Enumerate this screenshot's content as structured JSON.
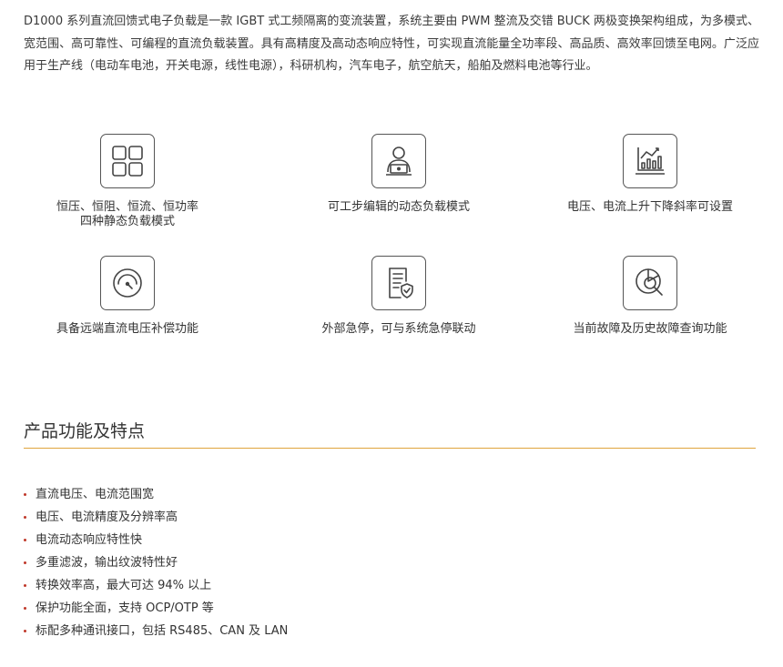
{
  "intro": {
    "text": "D1000 系列直流回馈式电子负载是一款 IGBT 式工频隔离的变流装置，系统主要由 PWM 整流及交错 BUCK 两极变换架构组成，为多模式、宽范围、高可靠性、可编程的直流负载装置。具有高精度及高动态响应特性，可实现直流能量全功率段、高品质、高效率回馈至电网。广泛应用于生产线（电动车电池，开关电源，线性电源），科研机构，汽车电子，航空航天，船舶及燃料电池等行业。"
  },
  "features": [
    {
      "icon": "grid-icon",
      "lines": [
        "恒压、恒阻、恒流、恒功率",
        "四种静态负载模式"
      ]
    },
    {
      "icon": "user-laptop-icon",
      "lines": [
        "可工步编辑的动态负载模式"
      ]
    },
    {
      "icon": "line-chart-icon",
      "lines": [
        "电压、电流上升下降斜率可设置"
      ]
    },
    {
      "icon": "gauge-icon",
      "lines": [
        "具备远端直流电压补偿功能"
      ]
    },
    {
      "icon": "document-shield-icon",
      "lines": [
        "外部急停，可与系统急停联动"
      ]
    },
    {
      "icon": "pie-chart-search-icon",
      "lines": [
        "当前故障及历史故障查询功能"
      ]
    }
  ],
  "section": {
    "title": "产品功能及特点",
    "accent_color": "#e0a43c"
  },
  "specs": [
    "直流电压、电流范围宽",
    "电压、电流精度及分辨率高",
    "电流动态响应特性快",
    "多重滤波，输出纹波特性好",
    "转换效率高，最大可达 94% 以上",
    "保护功能全面，支持 OCP/OTP 等",
    "标配多种通讯接口，包括 RS485、CAN 及 LAN"
  ],
  "bullet_color": "#c0392b"
}
